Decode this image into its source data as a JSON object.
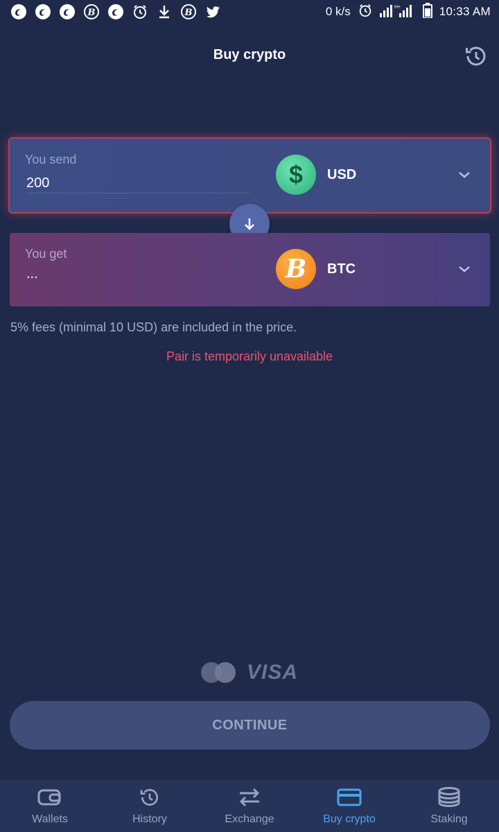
{
  "status_bar": {
    "network_speed": "0 k/s",
    "time": "10:33 AM"
  },
  "header": {
    "title": "Buy crypto"
  },
  "send": {
    "label": "You send",
    "amount": "200",
    "currency": "USD",
    "coin_symbol": "$"
  },
  "get": {
    "label": "You get",
    "amount": "...",
    "currency": "BTC",
    "coin_symbol": "B"
  },
  "fees_note": "5% fees (minimal 10 USD) are included in the price.",
  "error_message": "Pair is temporarily unavailable",
  "payment": {
    "visa_label": "VISA"
  },
  "continue_label": "CONTINUE",
  "nav": {
    "items": [
      {
        "label": "Wallets",
        "icon": "wallet-icon"
      },
      {
        "label": "History",
        "icon": "history-icon"
      },
      {
        "label": "Exchange",
        "icon": "exchange-icon"
      },
      {
        "label": "Buy crypto",
        "icon": "card-icon"
      },
      {
        "label": "Staking",
        "icon": "coins-stack-icon"
      }
    ],
    "active_index": 3
  },
  "colors": {
    "background": "#1f2a4a",
    "accent": "#4aa3f0",
    "error": "#e9556a",
    "usd_coin": "#3cc48c",
    "btc_coin": "#f7931a"
  }
}
